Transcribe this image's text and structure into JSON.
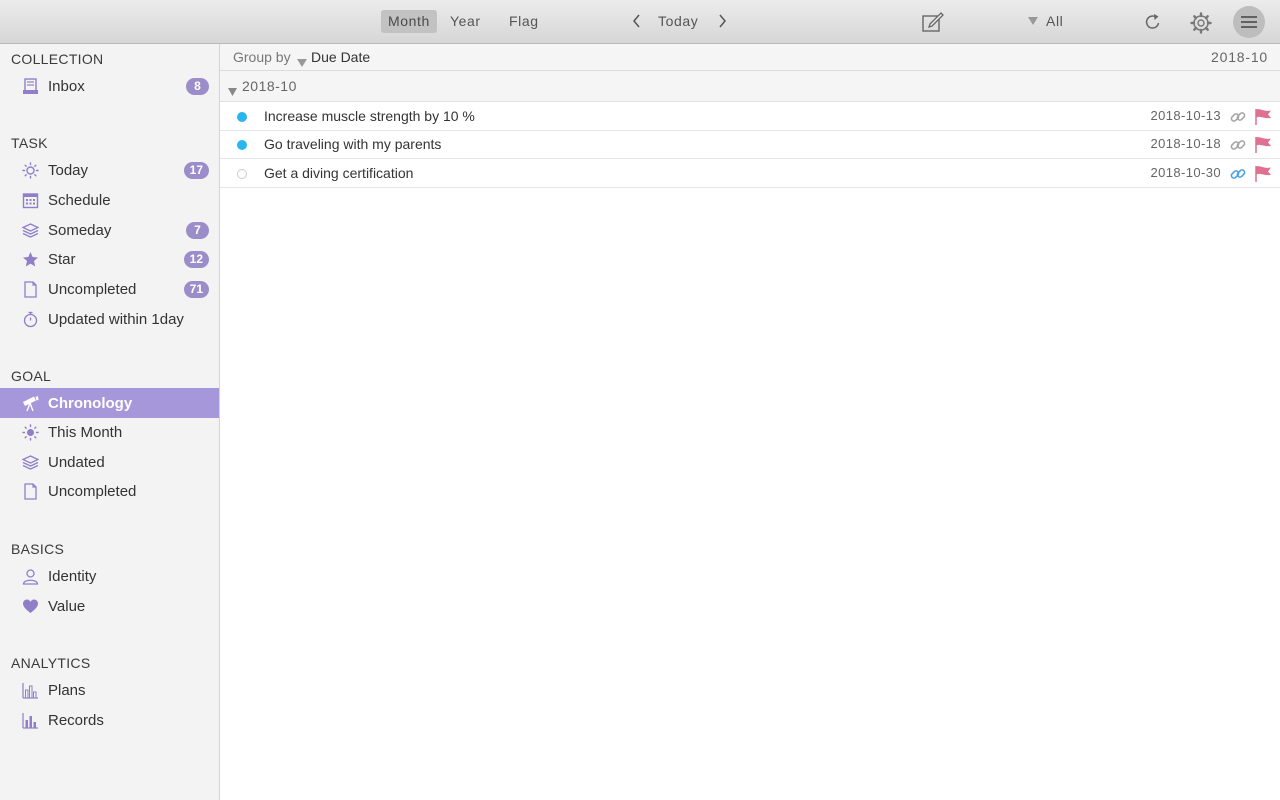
{
  "toolbar": {
    "segments": [
      "Month",
      "Year",
      "Flag"
    ],
    "active_segment": "Month",
    "today_label": "Today",
    "filter_label": "All",
    "icons": [
      "chevron-left-icon",
      "chevron-right-icon",
      "compose-icon",
      "filter-triangle-icon",
      "refresh-icon",
      "gear-icon",
      "menu-icon"
    ]
  },
  "sidebar": {
    "collection": {
      "title": "COLLECTION",
      "items": [
        {
          "label": "Inbox",
          "badge": "8",
          "icon": "inbox-icon"
        }
      ]
    },
    "task": {
      "title": "TASK",
      "items": [
        {
          "label": "Today",
          "badge": "17",
          "icon": "sun-icon"
        },
        {
          "label": "Schedule",
          "badge": "",
          "icon": "calendar-icon"
        },
        {
          "label": "Someday",
          "badge": "7",
          "icon": "layers-icon"
        },
        {
          "label": "Star",
          "badge": "12",
          "icon": "star-icon"
        },
        {
          "label": "Uncompleted",
          "badge": "71",
          "icon": "document-icon"
        },
        {
          "label": "Updated within 1day",
          "badge": "",
          "icon": "stopwatch-icon"
        }
      ]
    },
    "goal": {
      "title": "GOAL",
      "items": [
        {
          "label": "Chronology",
          "icon": "telescope-icon",
          "selected": true
        },
        {
          "label": "This Month",
          "icon": "sun-icon"
        },
        {
          "label": "Undated",
          "icon": "layers-icon"
        },
        {
          "label": "Uncompleted",
          "icon": "document-icon"
        }
      ]
    },
    "basics": {
      "title": "BASICS",
      "items": [
        {
          "label": "Identity",
          "icon": "person-icon"
        },
        {
          "label": "Value",
          "icon": "heart-icon"
        }
      ]
    },
    "analytics": {
      "title": "ANALYTICS",
      "items": [
        {
          "label": "Plans",
          "icon": "bar-chart-outline-icon"
        },
        {
          "label": "Records",
          "icon": "bar-chart-icon"
        }
      ]
    }
  },
  "main": {
    "group_by_label": "Group by",
    "group_by_value": "Due Date",
    "current_period": "2018-10",
    "group_header": "2018-10",
    "tasks": [
      {
        "title": "Increase muscle strength by 10 %",
        "date": "2018-10-13",
        "status": "active",
        "status_color": "#29b5ee",
        "link_color": "#a6a6a6",
        "flag_color": "#e0708f"
      },
      {
        "title": "Go traveling with my parents",
        "date": "2018-10-18",
        "status": "active",
        "status_color": "#29b5ee",
        "link_color": "#a6a6a6",
        "flag_color": "#e0708f"
      },
      {
        "title": "Get a diving certification",
        "date": "2018-10-30",
        "status": "empty",
        "status_color": "#cccccc",
        "link_color": "#4aa3e6",
        "flag_color": "#e0708f"
      }
    ]
  },
  "colors": {
    "accent": "#a597d9",
    "badge": "#9a8dc9",
    "icon": "#8f7fc9"
  }
}
